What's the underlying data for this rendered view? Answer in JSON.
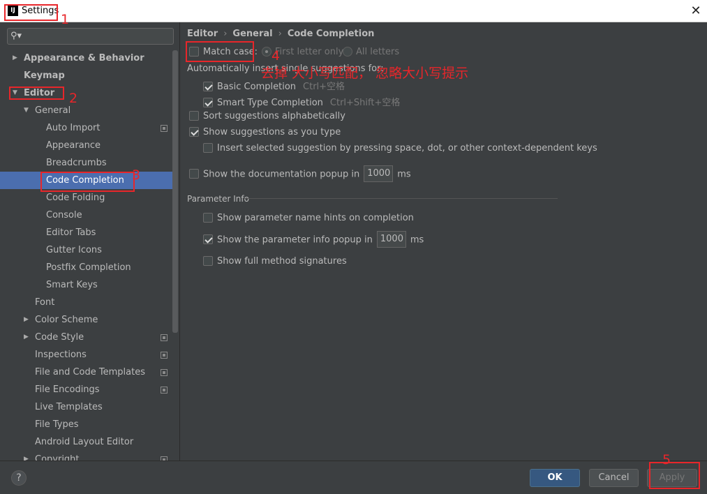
{
  "window": {
    "title": "Settings",
    "app_icon": "IJ"
  },
  "search": {
    "placeholder": ""
  },
  "tree": [
    {
      "label": "Appearance & Behavior",
      "level": 0,
      "bold": true,
      "arrow": "right",
      "copy": false,
      "selected": false
    },
    {
      "label": "Keymap",
      "level": 0,
      "bold": true,
      "arrow": "",
      "copy": false,
      "selected": false
    },
    {
      "label": "Editor",
      "level": 0,
      "bold": true,
      "arrow": "down",
      "copy": false,
      "selected": false
    },
    {
      "label": "General",
      "level": 1,
      "bold": false,
      "arrow": "down",
      "copy": false,
      "selected": false
    },
    {
      "label": "Auto Import",
      "level": 2,
      "bold": false,
      "arrow": "",
      "copy": true,
      "selected": false
    },
    {
      "label": "Appearance",
      "level": 2,
      "bold": false,
      "arrow": "",
      "copy": false,
      "selected": false
    },
    {
      "label": "Breadcrumbs",
      "level": 2,
      "bold": false,
      "arrow": "",
      "copy": false,
      "selected": false
    },
    {
      "label": "Code Completion",
      "level": 2,
      "bold": false,
      "arrow": "",
      "copy": false,
      "selected": true
    },
    {
      "label": "Code Folding",
      "level": 2,
      "bold": false,
      "arrow": "",
      "copy": false,
      "selected": false
    },
    {
      "label": "Console",
      "level": 2,
      "bold": false,
      "arrow": "",
      "copy": false,
      "selected": false
    },
    {
      "label": "Editor Tabs",
      "level": 2,
      "bold": false,
      "arrow": "",
      "copy": false,
      "selected": false
    },
    {
      "label": "Gutter Icons",
      "level": 2,
      "bold": false,
      "arrow": "",
      "copy": false,
      "selected": false
    },
    {
      "label": "Postfix Completion",
      "level": 2,
      "bold": false,
      "arrow": "",
      "copy": false,
      "selected": false
    },
    {
      "label": "Smart Keys",
      "level": 2,
      "bold": false,
      "arrow": "",
      "copy": false,
      "selected": false
    },
    {
      "label": "Font",
      "level": 1,
      "bold": false,
      "arrow": "",
      "copy": false,
      "selected": false
    },
    {
      "label": "Color Scheme",
      "level": 1,
      "bold": false,
      "arrow": "right",
      "copy": false,
      "selected": false
    },
    {
      "label": "Code Style",
      "level": 1,
      "bold": false,
      "arrow": "right",
      "copy": true,
      "selected": false
    },
    {
      "label": "Inspections",
      "level": 1,
      "bold": false,
      "arrow": "",
      "copy": true,
      "selected": false
    },
    {
      "label": "File and Code Templates",
      "level": 1,
      "bold": false,
      "arrow": "",
      "copy": true,
      "selected": false
    },
    {
      "label": "File Encodings",
      "level": 1,
      "bold": false,
      "arrow": "",
      "copy": true,
      "selected": false
    },
    {
      "label": "Live Templates",
      "level": 1,
      "bold": false,
      "arrow": "",
      "copy": false,
      "selected": false
    },
    {
      "label": "File Types",
      "level": 1,
      "bold": false,
      "arrow": "",
      "copy": false,
      "selected": false
    },
    {
      "label": "Android Layout Editor",
      "level": 1,
      "bold": false,
      "arrow": "",
      "copy": false,
      "selected": false
    },
    {
      "label": "Copyright",
      "level": 1,
      "bold": false,
      "arrow": "right",
      "copy": true,
      "selected": false
    }
  ],
  "breadcrumb": [
    "Editor",
    "General",
    "Code Completion"
  ],
  "options": {
    "match_case": {
      "label": "Match case:",
      "checked": false
    },
    "first_letter_only": {
      "label": "First letter only",
      "selected": true
    },
    "all_letters": {
      "label": "All letters",
      "selected": false
    },
    "auto_insert_label": "Automatically insert single suggestions for:",
    "basic_completion": {
      "label": "Basic Completion",
      "shortcut": "Ctrl+空格",
      "checked": true
    },
    "smart_type_completion": {
      "label": "Smart Type Completion",
      "shortcut": "Ctrl+Shift+空格",
      "checked": true
    },
    "sort_alphabetically": {
      "label": "Sort suggestions alphabetically",
      "checked": false
    },
    "show_as_you_type": {
      "label": "Show suggestions as you type",
      "checked": true
    },
    "insert_by_space": {
      "label": "Insert selected suggestion by pressing space, dot, or other context-dependent keys",
      "checked": false
    },
    "doc_popup": {
      "label": "Show the documentation popup in",
      "value": "1000",
      "unit": "ms",
      "checked": false
    }
  },
  "parameter_info": {
    "title": "Parameter Info",
    "name_hints": {
      "label": "Show parameter name hints on completion",
      "checked": false
    },
    "info_popup": {
      "label": "Show the parameter info popup in",
      "value": "1000",
      "unit": "ms",
      "checked": true
    },
    "full_signatures": {
      "label": "Show full method signatures",
      "checked": false
    }
  },
  "annotations": {
    "n1": "1",
    "n2": "2",
    "n3": "3",
    "n4": "4",
    "n5": "5",
    "note": "去掉 大小写匹配， 忽略大小写提示",
    "color": "#e8262a"
  },
  "footer": {
    "help": "?",
    "ok": "OK",
    "cancel": "Cancel",
    "apply": "Apply"
  },
  "colors": {
    "background": "#3c3f41",
    "selection": "#4b6eaf",
    "primary_button": "#365880"
  }
}
